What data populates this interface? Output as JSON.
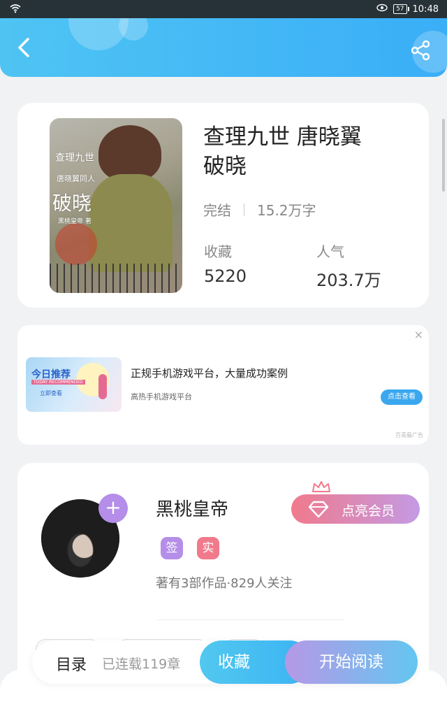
{
  "status": {
    "time": "10:48",
    "battery": "57"
  },
  "book": {
    "title": "查理九世 唐晓翼 破晓",
    "status": "完结",
    "word_count": "15.2万字",
    "fav_label": "收藏",
    "fav_value": "5220",
    "pop_label": "人气",
    "pop_value": "203.7万",
    "cover_title": "破晓",
    "cover_line1": "查理九世",
    "cover_line2": "唐晓翼同人",
    "cover_line3": "黑桃皇帝 著"
  },
  "ad": {
    "title": "正规手机游戏平台，大量成功案例",
    "subtitle": "高热手机游戏平台",
    "button": "点击查看",
    "tag": "百青藤广告",
    "close": "×",
    "img_line1": "今日推荐",
    "img_line2": "TODAY RECOMMENDED",
    "img_line3": "立即查看"
  },
  "author": {
    "name": "黑桃皇帝",
    "badge1": "签",
    "badge2": "实",
    "info": "著有3部作品·829人关注",
    "vip": "点亮会员",
    "follow": "+"
  },
  "bottom": {
    "catalog": "目录",
    "chapters": "已连载119章",
    "favorite": "收藏",
    "read": "开始阅读"
  },
  "colors": {
    "header": "#3aaef7",
    "vip_start": "#f07a8c",
    "vip_end": "#c49ae4",
    "badge1": "#b48ee8",
    "badge2": "#f07a8c"
  }
}
